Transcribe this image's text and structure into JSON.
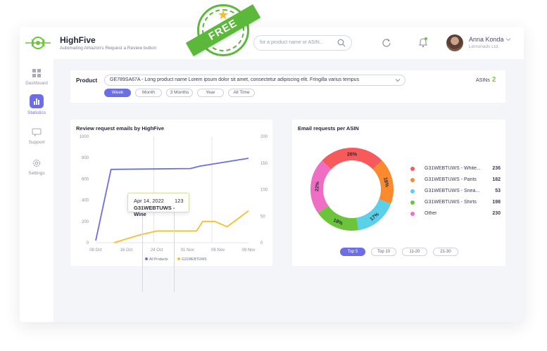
{
  "app": {
    "name": "HighFive",
    "tagline": "Automating Amazon's Request a Review button",
    "badge": "FREE"
  },
  "header": {
    "search_placeholder": "for a product name or ASIN...",
    "user_name": "Anna Konda",
    "user_company": "Lemonads Ltd."
  },
  "sidebar": {
    "items": [
      {
        "label": "Dashboard",
        "icon": "grid-icon",
        "active": false
      },
      {
        "label": "Statistics",
        "icon": "bar-chart-icon",
        "active": true
      },
      {
        "label": "Support",
        "icon": "chat-icon",
        "active": false
      },
      {
        "label": "Settings",
        "icon": "gear-icon",
        "active": false
      }
    ]
  },
  "filters": {
    "product_label": "Product",
    "product_value": "GE789SA67A - Long product name Lorem ipsum dolor sit amet, consectetur adipiscing elit. Fringilla varius tempus",
    "ranges": [
      "Week",
      "Month",
      "3 Months",
      "Year",
      "All Time"
    ],
    "active_range": "Week",
    "asins_label": "ASINs",
    "asins_count": "2"
  },
  "line_card": {
    "title": "Review request emails by HighFive",
    "tooltip": {
      "date": "Apr 14, 2022",
      "value": "123",
      "product": "G31WEBTUWS - Wine"
    }
  },
  "donut_card": {
    "title": "Email requests per ASIN",
    "pagers": [
      "Top 5",
      "Top 10",
      "11-20",
      "21-30"
    ],
    "active_pager": "Top 5"
  },
  "chart_data": [
    {
      "type": "line",
      "title": "Review request emails by HighFive",
      "x": [
        "08 Oct",
        "16 Oct",
        "24 Oct",
        "01 Nov",
        "09 Nov",
        "09 Nov"
      ],
      "ylim": [
        0,
        1000
      ],
      "y_ticks": [
        0,
        200,
        400,
        600,
        800,
        1000
      ],
      "y2lim": [
        0,
        200
      ],
      "y2_ticks": [
        0,
        50,
        100,
        150,
        200
      ],
      "grid": true,
      "legend": "bottom",
      "series": [
        {
          "name": "All Products",
          "axis": "left",
          "color": "#6c6ee6",
          "points": [
            [
              0,
              20
            ],
            [
              0.5,
              690
            ],
            [
              3.1,
              698
            ],
            [
              3.4,
              720
            ],
            [
              5.0,
              795
            ]
          ]
        },
        {
          "name": "G31WEBTUWS",
          "axis": "right",
          "color": "#f6be2a",
          "points": [
            [
              0.6,
              0
            ],
            [
              1.4,
              14
            ],
            [
              2.0,
              22
            ],
            [
              3.3,
              22
            ],
            [
              3.5,
              40
            ],
            [
              3.9,
              40
            ],
            [
              4.3,
              30
            ],
            [
              5.0,
              60
            ]
          ]
        }
      ]
    },
    {
      "type": "pie",
      "title": "Email requests per ASIN",
      "legend": "right",
      "slices": [
        {
          "name": "G31WEBTUWS - White...",
          "value": 236,
          "percent": 26,
          "color": "#f65a5a"
        },
        {
          "name": "G31WEBTUWS - Pants",
          "value": 182,
          "percent": 18,
          "color": "#f98a2d"
        },
        {
          "name": "G31WEBTUWS - Snea...",
          "value": 53,
          "percent": 17,
          "color": "#5bd0e8"
        },
        {
          "name": "G31WEBTUWS - Shirts",
          "value": 198,
          "percent": 18,
          "color": "#6cc43a"
        },
        {
          "name": "Other",
          "value": 230,
          "percent": 22,
          "color": "#ef6ec3"
        }
      ]
    }
  ]
}
